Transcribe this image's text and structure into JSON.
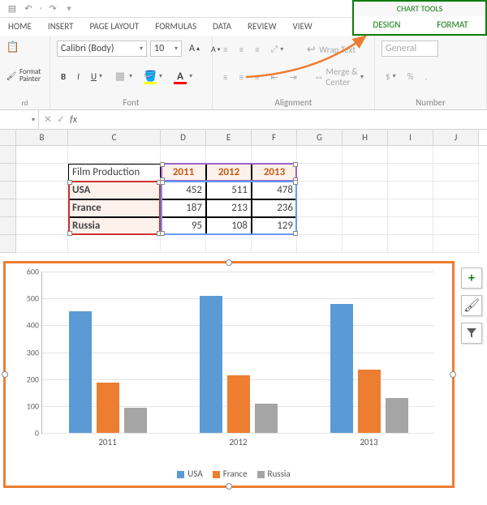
{
  "qat": {
    "undo": "↶",
    "redo": "↷"
  },
  "tabs": {
    "home": "HOME",
    "insert": "INSERT",
    "pagelayout": "PAGE LAYOUT",
    "formulas": "FORMULAS",
    "data": "DATA",
    "review": "REVIEW",
    "view": "VIEW"
  },
  "chart_tools": {
    "title": "CHART TOOLS",
    "design": "DESIGN",
    "format": "FORMAT"
  },
  "ribbon": {
    "clipboard": {
      "format_painter": "Format Painter",
      "label": "Clipboard"
    },
    "font": {
      "name": "Calibri (Body)",
      "size": "10",
      "increase": "A▲",
      "decrease": "A▼",
      "bold": "B",
      "italic": "I",
      "underline": "U",
      "label": "Font"
    },
    "alignment": {
      "wrap_text": "Wrap Text",
      "merge_center": "Merge & Center",
      "label": "Alignment"
    },
    "number": {
      "format": "General",
      "label": "Number"
    }
  },
  "formula_bar": {
    "name": "",
    "cancel": "✕",
    "enter": "✓",
    "fx": "fx",
    "value": ""
  },
  "columns": [
    "B",
    "C",
    "D",
    "E",
    "F",
    "G",
    "H",
    "I",
    "J"
  ],
  "table": {
    "corner": "Film Production",
    "years": [
      "2011",
      "2012",
      "2013"
    ],
    "rows": [
      {
        "label": "USA",
        "vals": [
          "452",
          "511",
          "478"
        ]
      },
      {
        "label": "France",
        "vals": [
          "187",
          "213",
          "236"
        ]
      },
      {
        "label": "Russia",
        "vals": [
          "95",
          "108",
          "129"
        ]
      }
    ]
  },
  "chart_data": {
    "type": "bar",
    "categories": [
      "2011",
      "2012",
      "2013"
    ],
    "series": [
      {
        "name": "USA",
        "values": [
          452,
          511,
          478
        ],
        "color": "#5B9BD5"
      },
      {
        "name": "France",
        "values": [
          187,
          213,
          236
        ],
        "color": "#ED7D31"
      },
      {
        "name": "Russia",
        "values": [
          95,
          108,
          129
        ],
        "color": "#A5A5A5"
      }
    ],
    "ylim": [
      0,
      600
    ],
    "yticks": [
      0,
      100,
      200,
      300,
      400,
      500,
      600
    ],
    "xlabel": "",
    "ylabel": "",
    "title": ""
  },
  "side_buttons": {
    "plus": "+",
    "brush": "🖌",
    "filter": "▼"
  }
}
